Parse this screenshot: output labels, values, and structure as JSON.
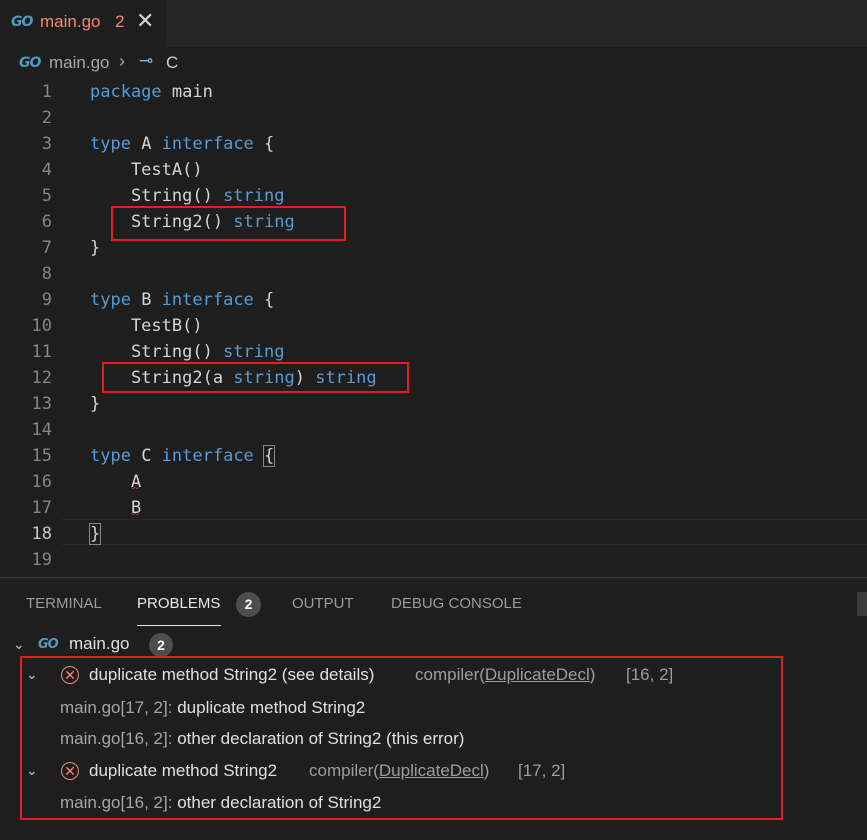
{
  "colors": {
    "error": "#f48771",
    "keyword": "#569cd6",
    "highlight_box": "#e02020"
  },
  "tab": {
    "icon": "go-logo",
    "logo_text": "GO",
    "title": "main.go",
    "problem_count": "2",
    "close_glyph": "✕"
  },
  "breadcrumb": {
    "file": "main.go",
    "separator": "›",
    "symbol_icon": "interface-icon",
    "symbol_glyph": "⊸",
    "symbol": "C"
  },
  "editor": {
    "lines": [
      {
        "n": "1",
        "tokens": [
          {
            "t": "package",
            "k": 1
          },
          {
            "t": " main",
            "k": 0
          }
        ]
      },
      {
        "n": "2",
        "tokens": []
      },
      {
        "n": "3",
        "tokens": [
          {
            "t": "type",
            "k": 1
          },
          {
            "t": " A ",
            "k": 0
          },
          {
            "t": "interface",
            "k": 1
          },
          {
            "t": " {",
            "k": 0
          }
        ]
      },
      {
        "n": "4",
        "tokens": [
          {
            "t": "    TestA()",
            "k": 0
          }
        ]
      },
      {
        "n": "5",
        "tokens": [
          {
            "t": "    String() ",
            "k": 0
          },
          {
            "t": "string",
            "k": 1
          }
        ]
      },
      {
        "n": "6",
        "tokens": [
          {
            "t": "    String2() ",
            "k": 0
          },
          {
            "t": "string",
            "k": 1
          }
        ]
      },
      {
        "n": "7",
        "tokens": [
          {
            "t": "}",
            "k": 0
          }
        ]
      },
      {
        "n": "8",
        "tokens": []
      },
      {
        "n": "9",
        "tokens": [
          {
            "t": "type",
            "k": 1
          },
          {
            "t": " B ",
            "k": 0
          },
          {
            "t": "interface",
            "k": 1
          },
          {
            "t": " {",
            "k": 0
          }
        ]
      },
      {
        "n": "10",
        "tokens": [
          {
            "t": "    TestB()",
            "k": 0
          }
        ]
      },
      {
        "n": "11",
        "tokens": [
          {
            "t": "    String() ",
            "k": 0
          },
          {
            "t": "string",
            "k": 1
          }
        ]
      },
      {
        "n": "12",
        "tokens": [
          {
            "t": "    String2(a ",
            "k": 0
          },
          {
            "t": "string",
            "k": 1
          },
          {
            "t": ") ",
            "k": 0
          },
          {
            "t": "string",
            "k": 1
          }
        ]
      },
      {
        "n": "13",
        "tokens": [
          {
            "t": "}",
            "k": 0
          }
        ]
      },
      {
        "n": "14",
        "tokens": []
      },
      {
        "n": "15",
        "tokens": [
          {
            "t": "type",
            "k": 1
          },
          {
            "t": " C ",
            "k": 0
          },
          {
            "t": "interface",
            "k": 1
          },
          {
            "t": " ",
            "k": 0
          },
          {
            "t": "{",
            "k": 2
          }
        ]
      },
      {
        "n": "16",
        "tokens": [
          {
            "t": "    A",
            "k": 0
          }
        ]
      },
      {
        "n": "17",
        "tokens": [
          {
            "t": "    B",
            "k": 0
          }
        ]
      },
      {
        "n": "18",
        "tokens": [
          {
            "t": "}",
            "k": 2
          }
        ]
      },
      {
        "n": "19",
        "tokens": []
      }
    ],
    "active_line": "18"
  },
  "panel": {
    "tabs": [
      "TERMINAL",
      "PROBLEMS",
      "OUTPUT",
      "DEBUG CONSOLE"
    ],
    "problems_badge": "2",
    "file": {
      "name": "main.go",
      "count": "2"
    },
    "problems": [
      {
        "message": "duplicate method String2 (see details)",
        "source_prefix": "compiler(",
        "source_code": "DuplicateDecl",
        "source_suffix": ")",
        "position": "[16, 2]",
        "details": [
          {
            "location": "main.go[17, 2]:",
            "text": "duplicate method String2"
          },
          {
            "location": "main.go[16, 2]:",
            "text": "other declaration of String2 (this error)"
          }
        ]
      },
      {
        "message": "duplicate method String2",
        "source_prefix": "compiler(",
        "source_code": "DuplicateDecl",
        "source_suffix": ")",
        "position": "[17, 2]",
        "details": [
          {
            "location": "main.go[16, 2]:",
            "text": "other declaration of String2"
          }
        ]
      }
    ]
  }
}
